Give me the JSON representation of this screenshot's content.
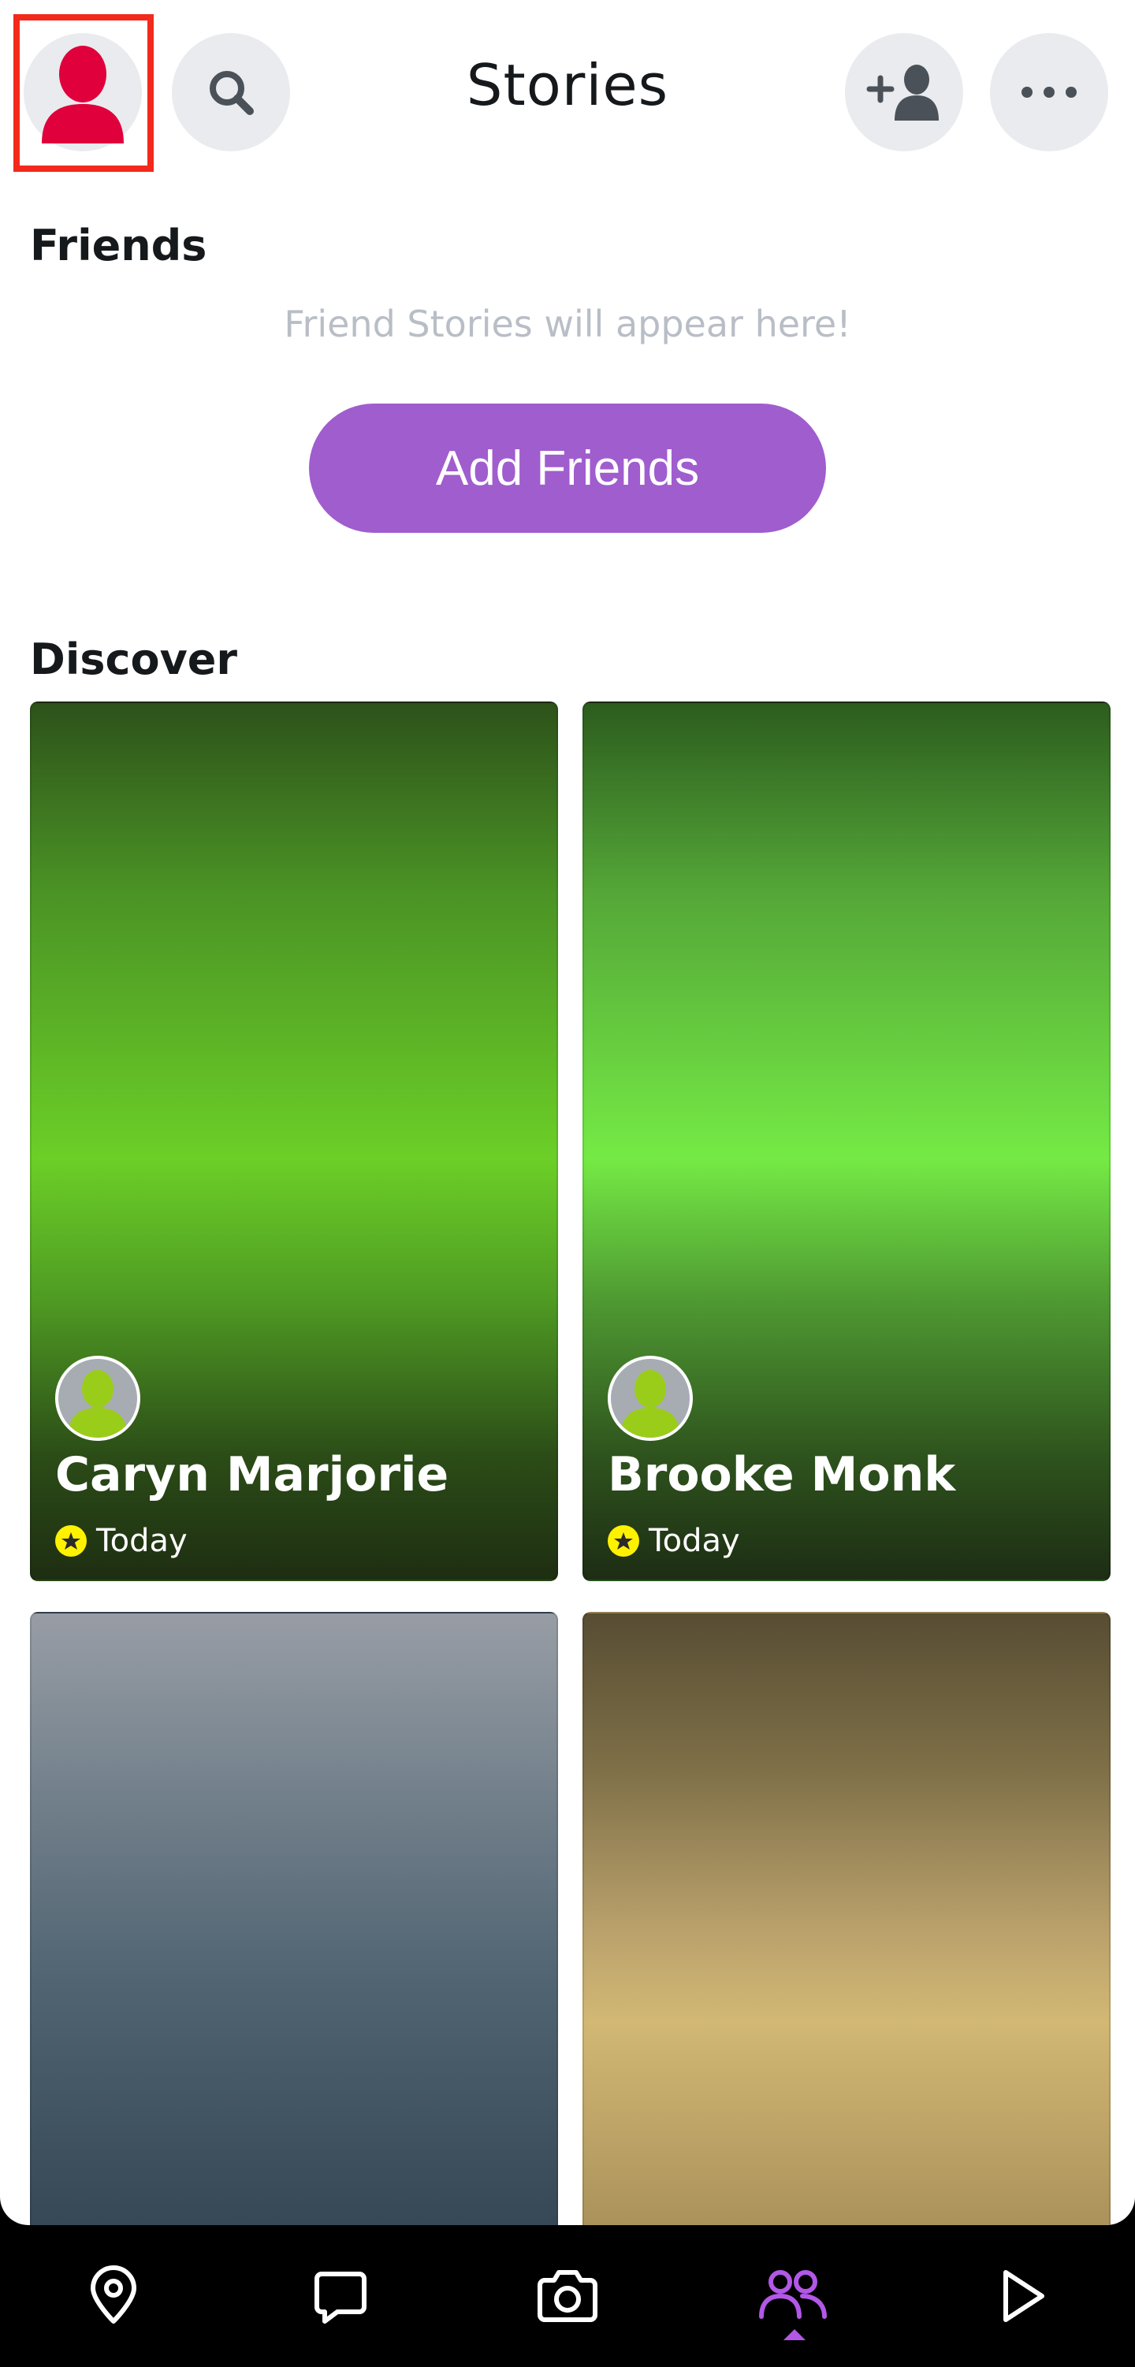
{
  "header": {
    "title": "Stories",
    "buttons": {
      "profile": "profile-avatar-icon",
      "search": "search-icon",
      "add_friend": "add-friend-icon",
      "more": "more-icon"
    }
  },
  "friends": {
    "title": "Friends",
    "empty_message": "Friend Stories will appear here!",
    "add_button_label": "Add Friends"
  },
  "discover": {
    "title": "Discover",
    "cards": [
      {
        "name": "Caryn Marjorie",
        "time": "Today"
      },
      {
        "name": "Brooke Monk",
        "time": "Today"
      },
      {
        "name": "",
        "time": ""
      },
      {
        "name": "",
        "time": ""
      }
    ]
  },
  "nav": {
    "items": [
      "map-pin-icon",
      "chat-icon",
      "camera-icon",
      "stories-icon",
      "spotlight-play-icon"
    ],
    "active": "stories-icon"
  },
  "colors": {
    "accent": "#a05dce",
    "highlight": "#f2291b",
    "active_nav": "#b257e6",
    "profile_avatar": "#e0003b"
  }
}
